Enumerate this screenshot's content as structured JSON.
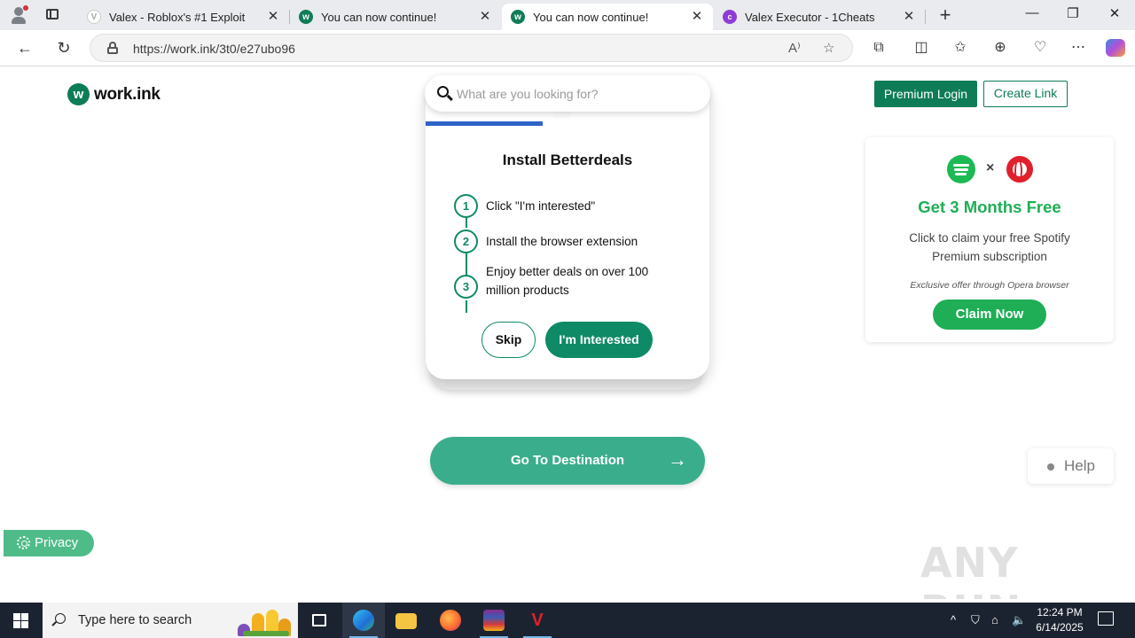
{
  "browser": {
    "tabs": [
      {
        "title": "Valex - Roblox's #1 Exploit",
        "favicon": "valex-icon",
        "active": false
      },
      {
        "title": "You can now continue!",
        "favicon": "workink-icon",
        "active": false
      },
      {
        "title": "You can now continue!",
        "favicon": "workink-icon",
        "active": true
      },
      {
        "title": "Valex Executor - 1Cheats",
        "favicon": "cheats-icon",
        "active": false
      }
    ],
    "url": "https://work.ink/3t0/e27ubo96",
    "close_glyph": "✕",
    "new_tab_glyph": "+"
  },
  "page": {
    "brand": {
      "logo_letter": "w",
      "name": "work.ink"
    },
    "search": {
      "placeholder": "What are you looking for?"
    },
    "header_buttons": {
      "premium_login": "Premium Login",
      "create_link": "Create Link"
    },
    "offer_card": {
      "title": "Install Betterdeals",
      "steps": [
        {
          "number": "1",
          "text": "Click \"I'm interested\""
        },
        {
          "number": "2",
          "text": "Install the browser extension"
        },
        {
          "number": "3",
          "text": "Enjoy better deals on over 100 million products"
        }
      ],
      "skip_label": "Skip",
      "interested_label": "I'm Interested"
    },
    "destination_button": {
      "label": "Go To Destination",
      "arrow": "→"
    },
    "ad": {
      "times_glyph": "×",
      "headline": "Get 3 Months Free",
      "body": "Click to claim your free Spotify Premium subscription",
      "fine_print": "Exclusive offer through Opera browser",
      "cta": "Claim Now"
    },
    "help_label": "Help",
    "privacy_label": "Privacy",
    "watermark": "ANY RUN"
  },
  "taskbar": {
    "search_placeholder": "Type here to search",
    "time": "12:24 PM",
    "date": "6/14/2025"
  },
  "colors": {
    "brand_green": "#0e7c57",
    "step_green": "#0e8a67",
    "destination_green": "#3aae8c",
    "spotify_green": "#1fae55",
    "opera_red": "#e0202c",
    "progress_blue": "#2e63c7"
  }
}
